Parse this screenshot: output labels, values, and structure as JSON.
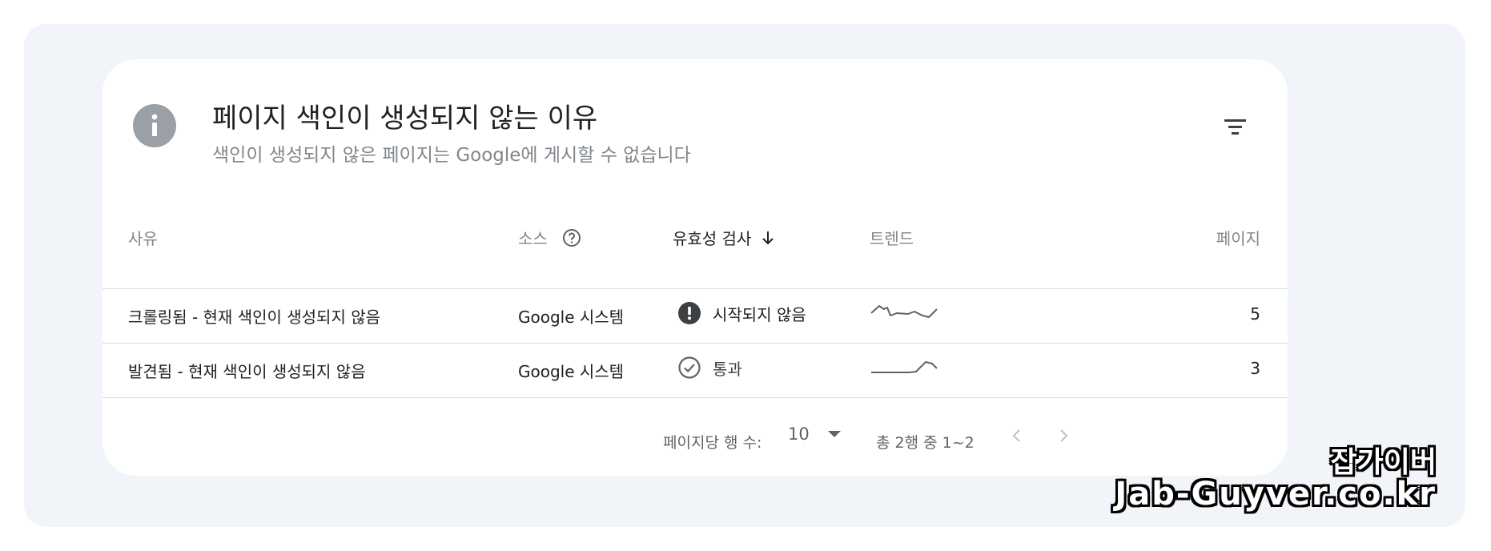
{
  "card": {
    "title": "페이지 색인이 생성되지 않는 이유",
    "subtitle": "색인이 생성되지 않은 페이지는 Google에 게시할 수 없습니다"
  },
  "table": {
    "headers": {
      "reason": "사유",
      "source": "소스",
      "validation": "유효성 검사",
      "trend": "트렌드",
      "pages": "페이지"
    },
    "rows": [
      {
        "reason": "크롤링됨 - 현재 색인이 생성되지 않음",
        "source": "Google 시스템",
        "validation": "시작되지 않음",
        "validation_icon": "exclamation-circle-icon",
        "pages": "5"
      },
      {
        "reason": "발견됨 - 현재 색인이 생성되지 않음",
        "source": "Google 시스템",
        "validation": "통과",
        "validation_icon": "check-circle-icon",
        "pages": "3"
      }
    ]
  },
  "footer": {
    "rows_per_page_label": "페이지당 행 수:",
    "rows_per_page_value": "10",
    "range_text": "총 2행 중 1~2"
  },
  "watermark": {
    "line1": "잡가이버",
    "line2": "Jab-Guyver.co.kr"
  },
  "colors": {
    "page_bg": "#f1f4f9",
    "card_bg": "#ffffff",
    "info_icon": "#9aa0a6",
    "error_icon": "#3c4043",
    "divider": "#dadce0",
    "muted_text": "#80868b",
    "text": "#202124"
  }
}
